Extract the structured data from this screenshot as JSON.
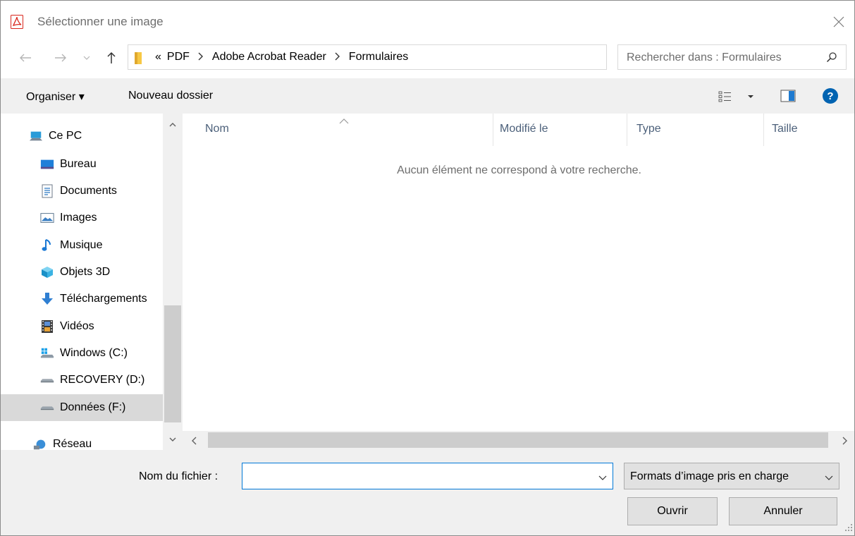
{
  "window": {
    "title": "Sélectionner une image"
  },
  "address": {
    "overflow": "«",
    "crumbs": [
      "PDF",
      "Adobe Acrobat Reader",
      "Formulaires"
    ]
  },
  "search": {
    "placeholder": "Rechercher dans : Formulaires"
  },
  "toolbar": {
    "organize": "Organiser ▾",
    "new_folder": "Nouveau dossier"
  },
  "nav_tree": {
    "items": [
      {
        "label": "Ce PC",
        "icon": "computer-icon"
      },
      {
        "label": "Bureau",
        "icon": "desktop-icon"
      },
      {
        "label": "Documents",
        "icon": "documents-icon"
      },
      {
        "label": "Images",
        "icon": "images-icon"
      },
      {
        "label": "Musique",
        "icon": "music-icon"
      },
      {
        "label": "Objets 3D",
        "icon": "objects-3d-icon"
      },
      {
        "label": "Téléchargements",
        "icon": "downloads-icon"
      },
      {
        "label": "Vidéos",
        "icon": "videos-icon"
      },
      {
        "label": "Windows (C:)",
        "icon": "windows-drive-icon"
      },
      {
        "label": "RECOVERY (D:)",
        "icon": "drive-icon"
      },
      {
        "label": "Données (F:)",
        "icon": "drive-icon",
        "selected": true
      },
      {
        "label": "Réseau",
        "icon": "network-icon"
      }
    ]
  },
  "file_list": {
    "columns": [
      "Nom",
      "Modifié le",
      "Type",
      "Taille"
    ],
    "empty_message": "Aucun élément ne correspond à votre recherche."
  },
  "bottom": {
    "filename_label": "Nom du fichier :",
    "filename_value": "",
    "filter": "Formats d’image pris en charge",
    "open_label": "Ouvrir",
    "cancel_label": "Annuler"
  },
  "colors": {
    "accent": "#0078d7",
    "selected": "#d9d9d9",
    "pane_bg": "#f0f0f0",
    "help": "#0063b1",
    "pdf_red": "#d9261c"
  }
}
